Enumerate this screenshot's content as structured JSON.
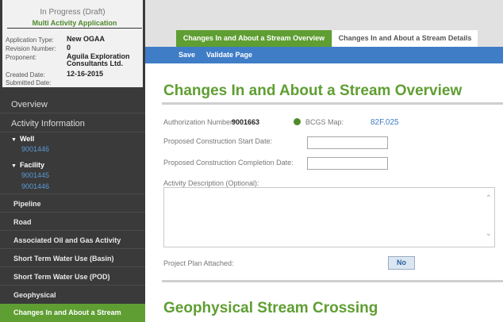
{
  "application": {
    "status": "In Progress (Draft)",
    "type_title": "Multi Activity Application",
    "fields": [
      {
        "label": "Application Type:",
        "value": "New OGAA"
      },
      {
        "label": "Revision Number:",
        "value": "0"
      },
      {
        "label": "Proponent:",
        "value": "Aguila Exploration Consultants Ltd."
      },
      {
        "label": "Created Date:",
        "value": "12-16-2015"
      },
      {
        "label": "Submitted Date:",
        "value": ""
      }
    ]
  },
  "sidebar": {
    "overview": "Overview",
    "activity_information": "Activity Information",
    "well": {
      "label": "Well",
      "links": [
        "9001446"
      ]
    },
    "facility": {
      "label": "Facility",
      "links": [
        "9001445",
        "9001446"
      ]
    },
    "items": [
      "Pipeline",
      "Road",
      "Associated Oil and Gas Activity",
      "Short Term Water Use (Basin)",
      "Short Term Water Use (POD)",
      "Geophysical",
      "Changes In and About a Stream"
    ]
  },
  "tabs": {
    "overview": "Changes In and About a Stream Overview",
    "details": "Changes In and About a Stream Details"
  },
  "actions": {
    "save": "Save",
    "validate": "Validate Page"
  },
  "main": {
    "title": "Changes In and About a Stream Overview",
    "authorization_label": "Authorization Number:",
    "authorization_value": "9001663",
    "bcgs_label": "BCGS Map:",
    "bcgs_value": "82F.025",
    "start_date_label": "Proposed Construction Start Date:",
    "completion_date_label": "Proposed Construction Completion Date:",
    "description_label": "Activity Description (Optional):",
    "project_plan_label": "Project Plan Attached:",
    "project_plan_value": "No",
    "section2_title": "Geophysical Stream Crossing"
  },
  "colors": {
    "brand_green": "#5f9e32",
    "action_blue": "#3f7dc7",
    "sidebar_bg": "#3a3a3a"
  }
}
